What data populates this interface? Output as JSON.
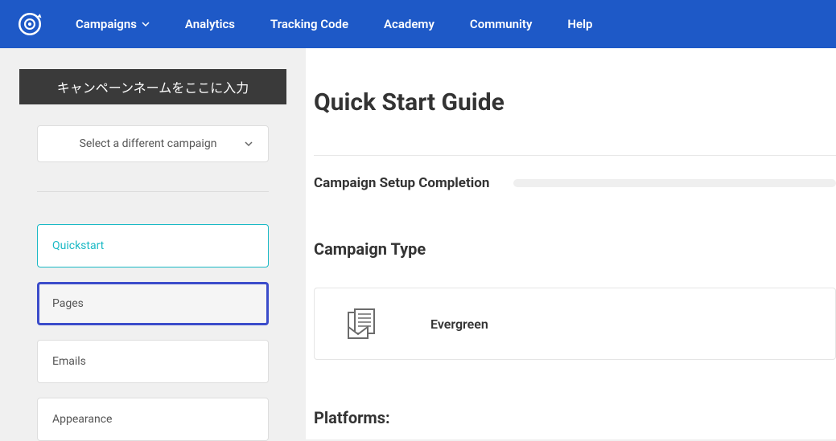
{
  "nav": {
    "items": [
      {
        "label": "Campaigns",
        "hasDropdown": true
      },
      {
        "label": "Analytics",
        "hasDropdown": false
      },
      {
        "label": "Tracking Code",
        "hasDropdown": false
      },
      {
        "label": "Academy",
        "hasDropdown": false
      },
      {
        "label": "Community",
        "hasDropdown": false
      },
      {
        "label": "Help",
        "hasDropdown": false
      }
    ]
  },
  "sidebar": {
    "campaign_name": "キャンペーンネームをここに入力",
    "select_label": "Select a different campaign",
    "items": [
      {
        "label": "Quickstart"
      },
      {
        "label": "Pages"
      },
      {
        "label": "Emails"
      },
      {
        "label": "Appearance"
      }
    ]
  },
  "main": {
    "title": "Quick Start Guide",
    "completion_label": "Campaign Setup Completion",
    "campaign_type_title": "Campaign Type",
    "campaign_type_value": "Evergreen",
    "platforms_title": "Platforms:"
  }
}
